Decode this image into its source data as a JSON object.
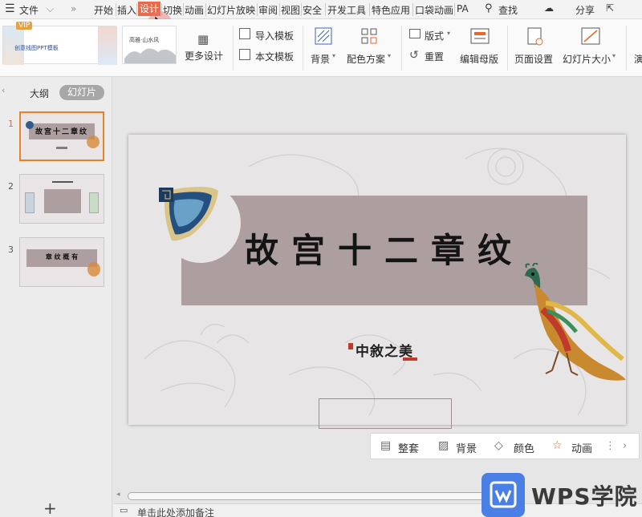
{
  "menubar": {
    "file_label": "文件",
    "tabs": [
      "开始",
      "插入",
      "设计",
      "切换",
      "动画",
      "幻灯片放映",
      "审阅",
      "视图",
      "安全",
      "开发工具",
      "特色应用",
      "口袋动画",
      "PA"
    ],
    "search_label": "查找",
    "share_label": "分享"
  },
  "ribbon": {
    "vip_label": "VIP",
    "template1_text": "创意线图PPT模板",
    "template2_text": "高雅·山水风",
    "more_designs": "更多设计",
    "import_template": "导入模板",
    "text_template": "本文模板",
    "background": "背景",
    "color_scheme": "配色方案",
    "layout": "版式",
    "reset": "重置",
    "edit_master": "编辑母版",
    "page_setup": "页面设置",
    "slide_size": "幻灯片大小",
    "cut_label": "演"
  },
  "leftpanel": {
    "tab_outline": "大纲",
    "tab_slides": "幻灯片",
    "slide_numbers": [
      "1",
      "2",
      "3"
    ],
    "thumb1_title": "故宫十二章纹",
    "thumb3_title": "章 纹 概 有"
  },
  "slide": {
    "title": "故宫十二章纹",
    "logo_text": "中敘之美"
  },
  "floatbar": {
    "items": [
      "整套",
      "背景",
      "颜色",
      "动画"
    ]
  },
  "notes": {
    "placeholder": "单击此处添加备注"
  },
  "watermark": {
    "text": "WPS学院"
  }
}
